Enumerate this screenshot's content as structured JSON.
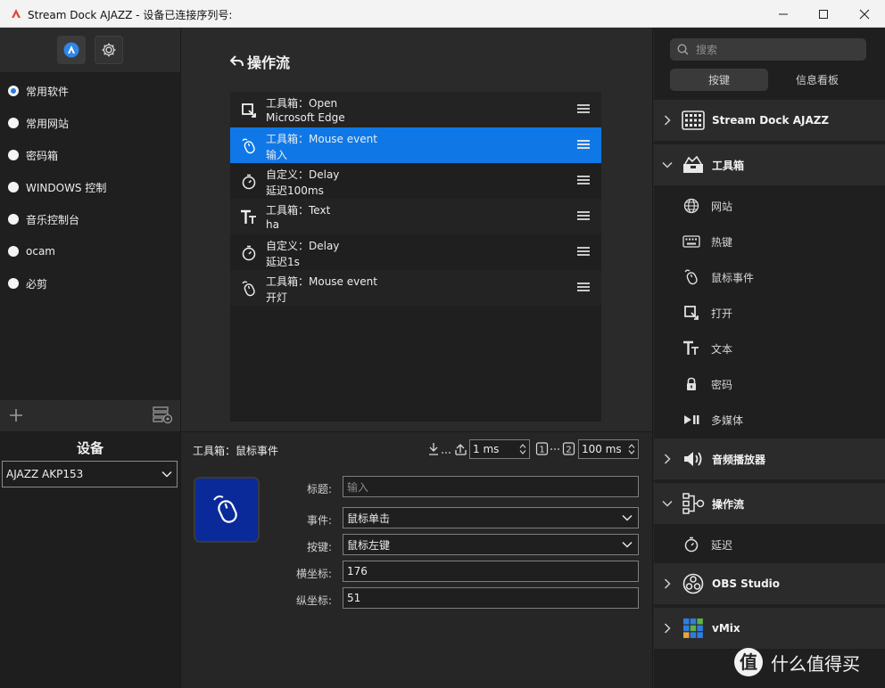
{
  "window": {
    "title": "Stream Dock AJAZZ - 设备已连接序列号:"
  },
  "profiles": [
    {
      "label": "常用软件",
      "selected": true
    },
    {
      "label": "常用网站",
      "selected": false
    },
    {
      "label": "密码箱",
      "selected": false
    },
    {
      "label": "WINDOWS 控制",
      "selected": false
    },
    {
      "label": "音乐控制台",
      "selected": false
    },
    {
      "label": "ocam",
      "selected": false
    },
    {
      "label": "必剪",
      "selected": false
    }
  ],
  "device": {
    "title": "设备",
    "selected": "AJAZZ AKP153"
  },
  "flow": {
    "title": "操作流",
    "items": [
      {
        "line1": "工具箱：Open",
        "line2": "Microsoft Edge",
        "icon": "open-icon",
        "selected": false
      },
      {
        "line1": "工具箱：Mouse event",
        "line2": "输入",
        "icon": "mouse-icon",
        "selected": true
      },
      {
        "line1": "自定义：Delay",
        "line2": "延迟100ms",
        "icon": "timer-icon",
        "selected": false
      },
      {
        "line1": "工具箱：Text",
        "line2": "ha",
        "icon": "text-icon",
        "selected": false
      },
      {
        "line1": "自定义：Delay",
        "line2": "延迟1s",
        "icon": "timer-icon",
        "selected": false
      },
      {
        "line1": "工具箱：Mouse event",
        "line2": "开灯",
        "icon": "mouse-icon",
        "selected": false
      }
    ]
  },
  "properties": {
    "title": "工具箱：鼠标事件",
    "interval_value": "1 ms",
    "repeat_value": "100 ms",
    "fields": {
      "title_label": "标题:",
      "title_placeholder": "输入",
      "event_label": "事件:",
      "event_value": "鼠标单击",
      "key_label": "按键:",
      "key_value": "鼠标左键",
      "x_label": "横坐标:",
      "x_value": "176",
      "y_label": "纵坐标:",
      "y_value": "51"
    }
  },
  "library": {
    "search_placeholder": "搜索",
    "tabs": {
      "keys": "按键",
      "info": "信息看板"
    },
    "categories": {
      "streamdock": "Stream Dock AJAZZ",
      "toolbox": "工具箱",
      "audio": "音频播放器",
      "flow": "操作流",
      "obs": "OBS Studio",
      "vmix": "vMix"
    },
    "toolbox_items": [
      "网站",
      "热键",
      "鼠标事件",
      "打开",
      "文本",
      "密码",
      "多媒体"
    ],
    "flow_items": [
      "延迟"
    ]
  },
  "watermark": "什么值得买",
  "colors": {
    "accent": "#0f78e6",
    "preview_bg": "#0a2a9a",
    "vmix_blue": "#2f7de1",
    "vmix_green": "#5db346"
  }
}
